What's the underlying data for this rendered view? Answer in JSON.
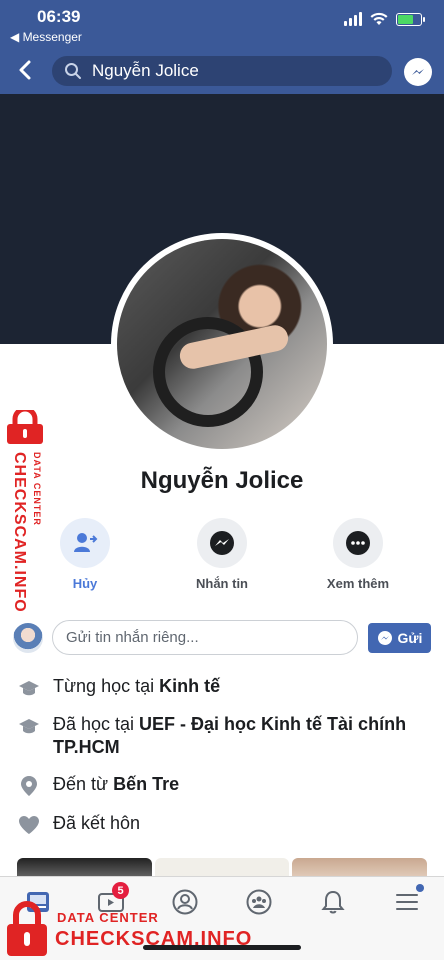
{
  "status_bar": {
    "time": "06:39",
    "back_app": "◀ Messenger"
  },
  "header": {
    "search_text": "Nguyễn Jolice"
  },
  "profile": {
    "name": "Nguyễn Jolice"
  },
  "actions": [
    {
      "label": "Hủy",
      "icon": "friend-cancel-icon"
    },
    {
      "label": "Nhắn tin",
      "icon": "messenger-icon"
    },
    {
      "label": "Xem thêm",
      "icon": "more-icon"
    }
  ],
  "compose": {
    "placeholder": "Gửi tin nhắn riêng...",
    "send_label": "Gửi"
  },
  "info": [
    {
      "icon": "education-icon",
      "prefix": "Từng học tại ",
      "bold": "Kinh tế"
    },
    {
      "icon": "education-icon",
      "prefix": "Đã học tại ",
      "bold": "UEF - Đại học Kinh tế Tài chính TP.HCM"
    },
    {
      "icon": "location-icon",
      "prefix": "Đến từ ",
      "bold": "Bến Tre"
    },
    {
      "icon": "heart-icon",
      "prefix": "Đã kết hôn",
      "bold": ""
    }
  ],
  "bottom_tabs": [
    {
      "name": "news-feed-tab"
    },
    {
      "name": "watch-tab",
      "badge": "5"
    },
    {
      "name": "profile-tab"
    },
    {
      "name": "groups-tab"
    },
    {
      "name": "notifications-tab"
    },
    {
      "name": "menu-tab"
    }
  ],
  "watermark": {
    "side_small": "DATA CENTER",
    "side_main": "CHECKSCAM.INFO",
    "bottom_small": "DATA CENTER",
    "bottom_main": "CHECKSCAM.INFO"
  },
  "colors": {
    "brand": "#3b5998",
    "accent": "#4267b2",
    "watermark": "#e02424"
  }
}
